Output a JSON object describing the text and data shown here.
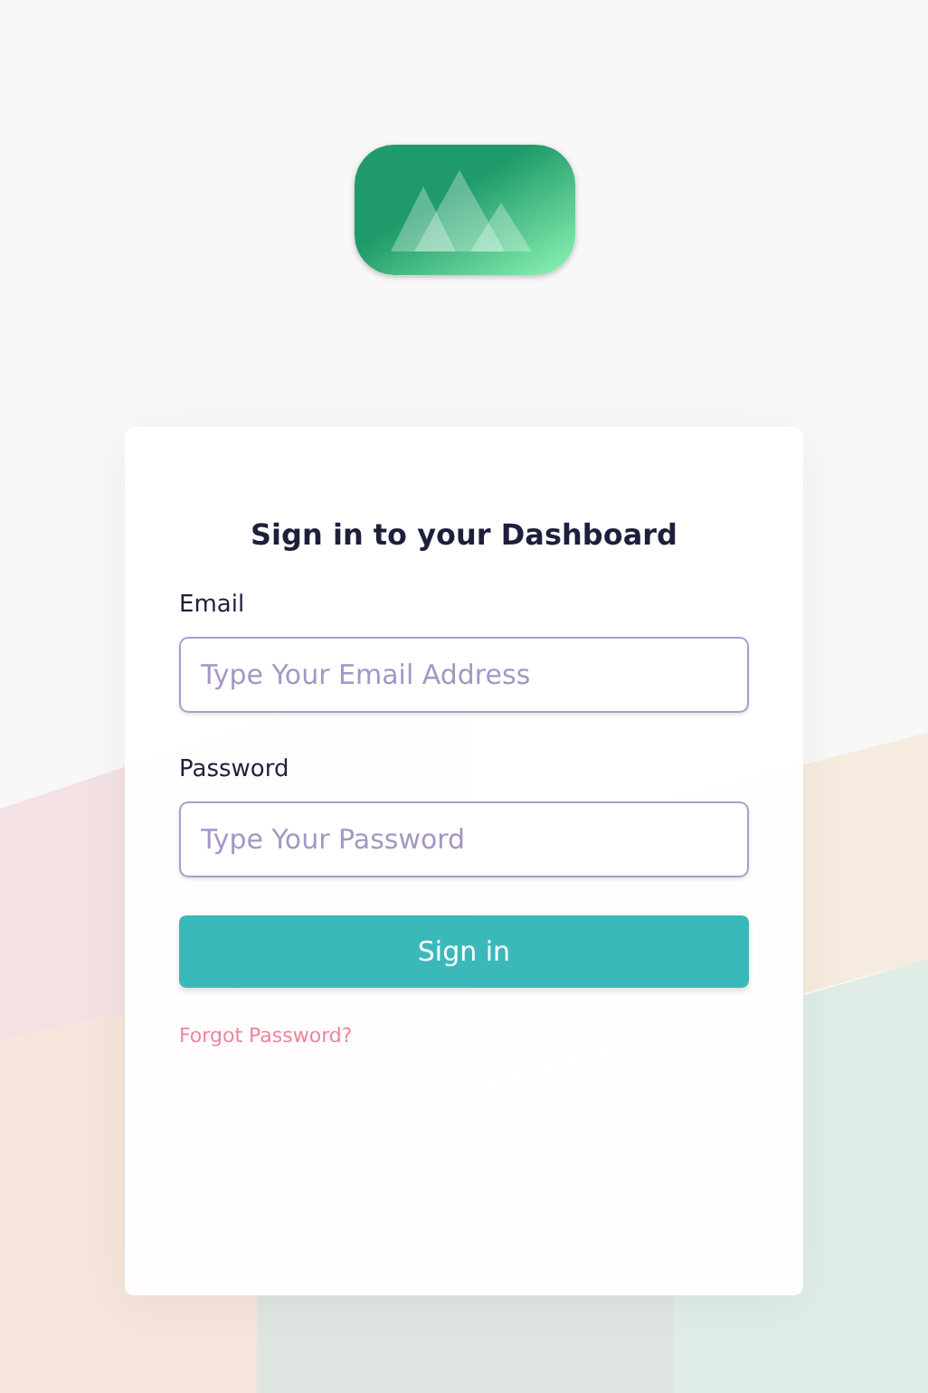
{
  "logo": {
    "kind": "mountains"
  },
  "card": {
    "title": "Sign in to your Dashboard",
    "fields": [
      {
        "label": "Email",
        "placeholder": "Type Your Email Address"
      },
      {
        "label": "Password",
        "placeholder": "Type Your Password"
      }
    ],
    "submit": "Sign in",
    "link": "Forgot Password?"
  }
}
